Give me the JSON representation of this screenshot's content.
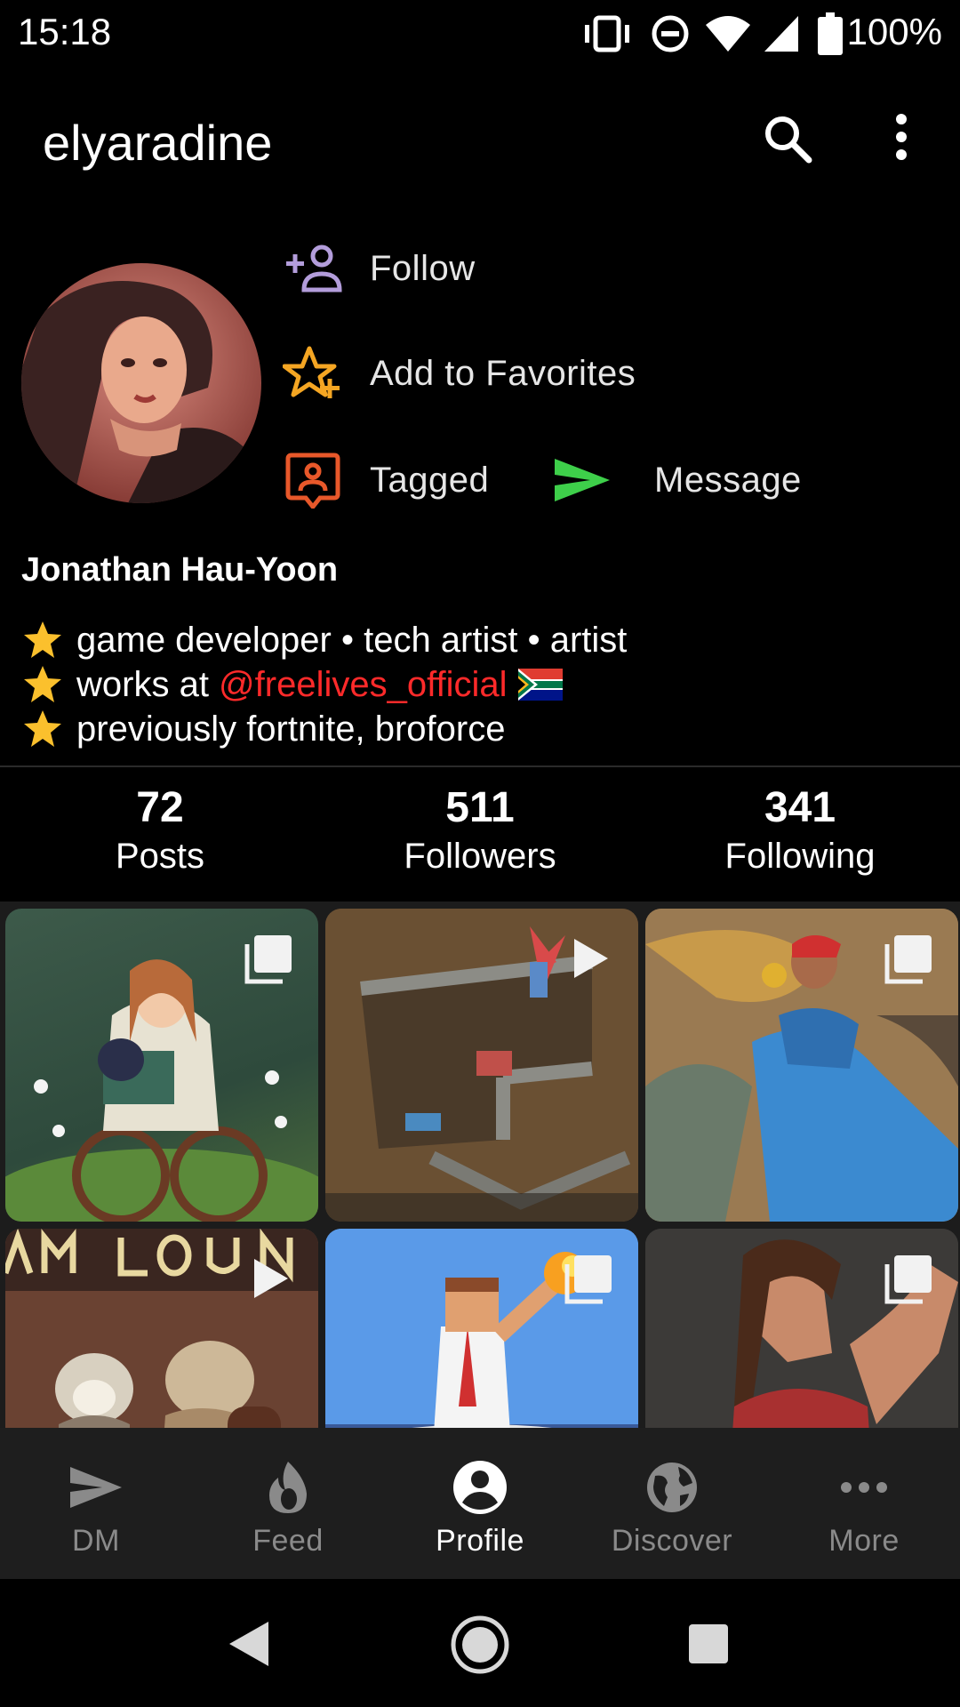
{
  "status_bar": {
    "time": "15:18",
    "battery": "100%"
  },
  "app": {
    "title": "elyaradine"
  },
  "profile": {
    "actions": {
      "follow": "Follow",
      "favorites": "Add to Favorites",
      "tagged": "Tagged",
      "message": "Message"
    },
    "display_name": "Jonathan Hau-Yoon",
    "bio": {
      "line1": "game developer • tech artist • artist",
      "line2_prefix": "works at ",
      "line2_mention": "@freelives_official",
      "line3": "previously fortnite, broforce"
    },
    "stats": [
      {
        "value": "72",
        "label": "Posts"
      },
      {
        "value": "511",
        "label": "Followers"
      },
      {
        "value": "341",
        "label": "Following"
      }
    ]
  },
  "nav": {
    "items": [
      {
        "label": "DM",
        "icon": "send-icon"
      },
      {
        "label": "Feed",
        "icon": "flame-icon"
      },
      {
        "label": "Profile",
        "icon": "account-circle-icon",
        "active": true
      },
      {
        "label": "Discover",
        "icon": "globe-icon"
      },
      {
        "label": "More",
        "icon": "more-horizontal-icon"
      }
    ]
  },
  "colors": {
    "follow_icon": "#b39ddb",
    "favorite_icon": "#f5a623",
    "tagged_icon": "#e8582a",
    "message_icon": "#3ecf4a",
    "mention": "#ff2a2a"
  }
}
